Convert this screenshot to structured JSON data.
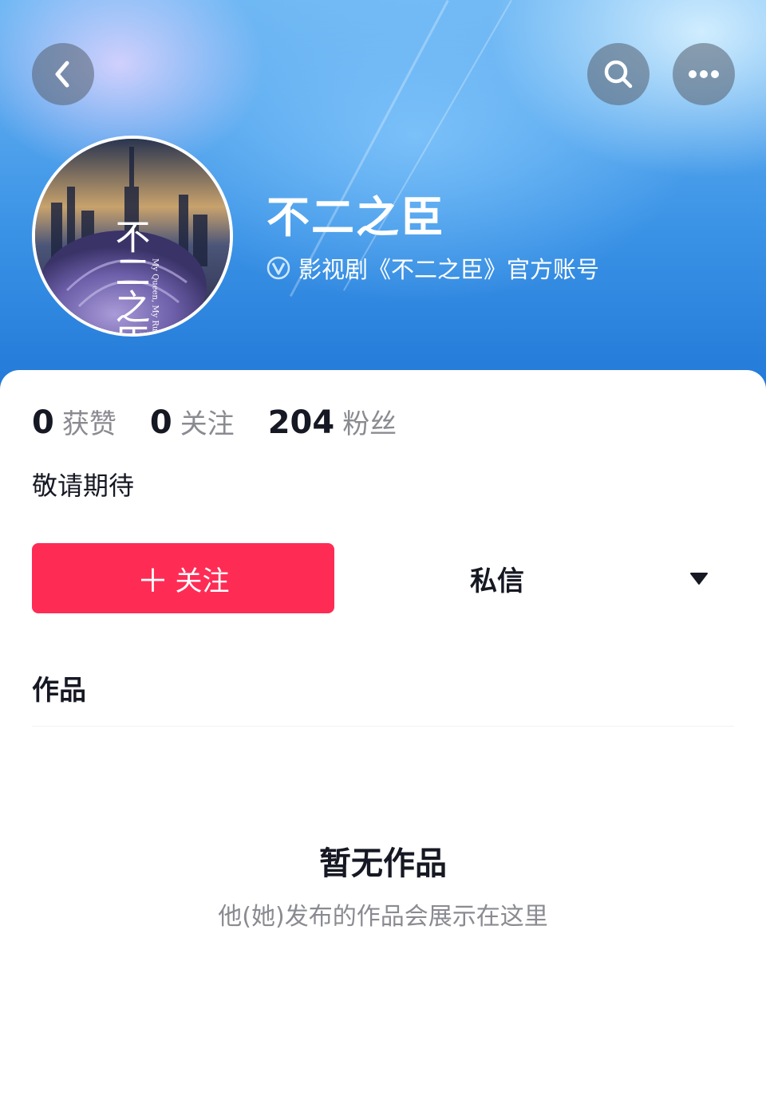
{
  "header": {
    "back_icon": "chevron-left-icon",
    "search_icon": "search-icon",
    "more_icon": "more-horizontal-icon"
  },
  "profile": {
    "name": "不二之臣",
    "verification": "影视剧《不二之臣》官方账号",
    "verified_icon": "verified-v-icon",
    "avatar": {
      "title": "不二之臣",
      "subtitle": "My Queen, My Rules"
    },
    "bio": "敬请期待"
  },
  "stats": [
    {
      "value": "0",
      "label": "获赞"
    },
    {
      "value": "0",
      "label": "关注"
    },
    {
      "value": "204",
      "label": "粉丝"
    }
  ],
  "actions": {
    "follow_plus": "＋",
    "follow_label": "关注",
    "message_label": "私信",
    "dropdown_icon": "caret-down-icon"
  },
  "tabs": {
    "works_label": "作品"
  },
  "empty_state": {
    "title": "暂无作品",
    "subtitle": "他(她)发布的作品会展示在这里"
  },
  "colors": {
    "accent": "#fe2c55",
    "header_blue": "#3b93e6",
    "text_primary": "#161823",
    "text_secondary": "#8a8b91"
  }
}
